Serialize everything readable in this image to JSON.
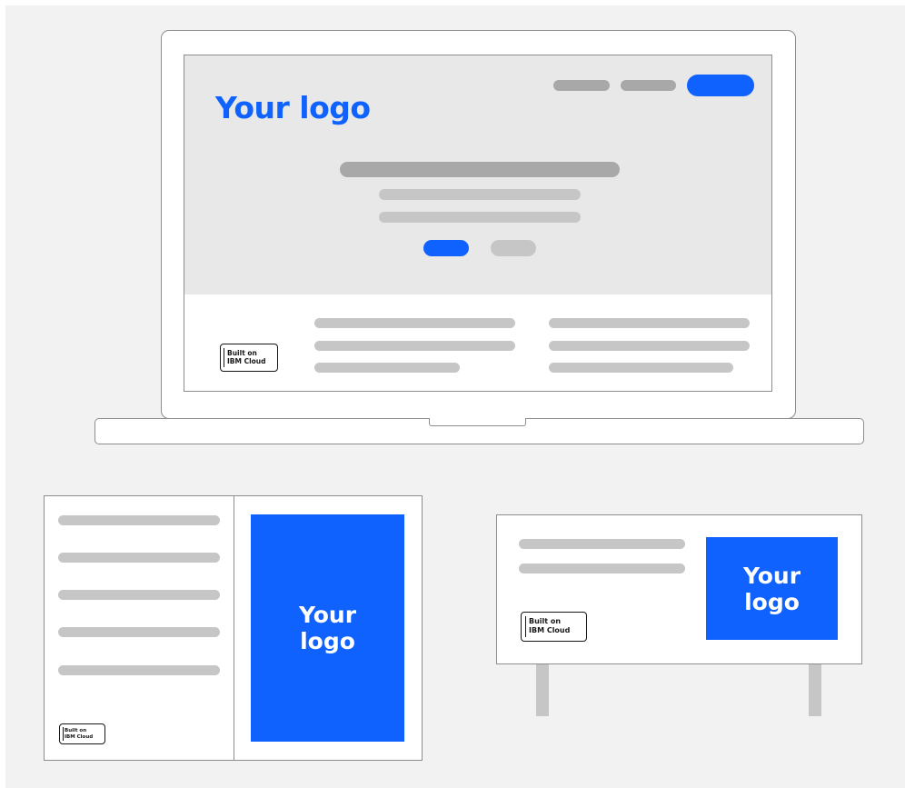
{
  "laptop": {
    "logo_text": "Your logo",
    "badge": {
      "line1": "Built on",
      "line2": "IBM Cloud"
    }
  },
  "brochure": {
    "logo_text": "Your logo",
    "badge": {
      "line1": "Built on",
      "line2": "IBM Cloud"
    }
  },
  "billboard": {
    "logo_text": "Your logo",
    "badge": {
      "line1": "Built on",
      "line2": "IBM Cloud"
    }
  },
  "colors": {
    "accent_blue": "#0f62fe",
    "placeholder_dark": "#a8a8a8",
    "placeholder_light": "#c6c6c6",
    "background": "#f2f2f2",
    "outline": "#8d8d8d"
  }
}
